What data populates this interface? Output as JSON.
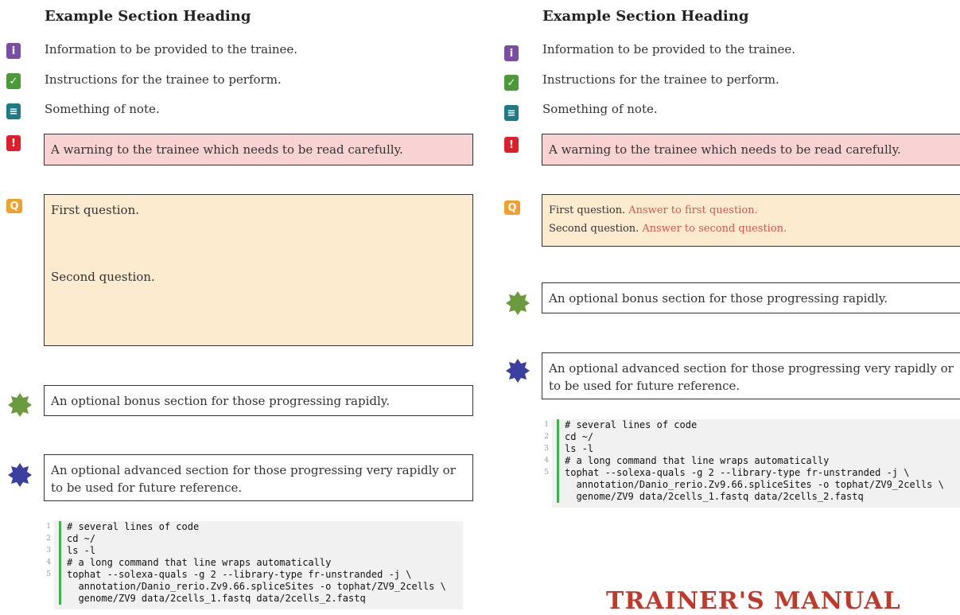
{
  "heading": "Example Section Heading",
  "info_text": "Information to be provided to the trainee.",
  "instructions_text": "Instructions for the trainee to perform.",
  "note_text": "Something of note.",
  "warning_text": "A warning to the trainee which needs to be read carefully.",
  "question1": "First question.",
  "question2": "Second question.",
  "answer1": "Answer to first question.",
  "answer2": "Answer to second question.",
  "bonus_text": "An optional bonus section for those progressing rapidly.",
  "advanced_text": "An optional advanced section for those progressing very rapidly or to be used for future reference.",
  "code_lines": [
    {
      "n": "1",
      "t": "# several lines of code"
    },
    {
      "n": "2",
      "t": "cd ~/"
    },
    {
      "n": "3",
      "t": "ls -l"
    },
    {
      "n": "4",
      "t": "# a long command that line wraps automatically"
    },
    {
      "n": "5",
      "t": "tophat --solexa-quals -g 2 --library-type fr-unstranded -j \\"
    },
    {
      "n": "",
      "t": "  annotation/Danio_rerio.Zv9.66.spliceSites -o tophat/ZV9_2cells \\"
    },
    {
      "n": "",
      "t": "  genome/ZV9 data/2cells_1.fastq data/2cells_2.fastq"
    }
  ],
  "footer_title": "TRAINER'S MANUAL",
  "colors": {
    "info_icon": "#7a4fa3",
    "instr_icon": "#4a9a3a",
    "note_icon": "#1d7a86",
    "warn_icon": "#e01e2b",
    "question_icon": "#f1a12b",
    "bonus_star": "#6b9a3f",
    "advanced_star": "#3a3fa0",
    "answer_text": "#d9534f",
    "code_bar": "#3cb44b"
  },
  "icons": [
    "info-icon",
    "instructions-icon",
    "note-icon",
    "warning-icon",
    "question-icon",
    "bonus-star-icon",
    "advanced-star-icon"
  ]
}
